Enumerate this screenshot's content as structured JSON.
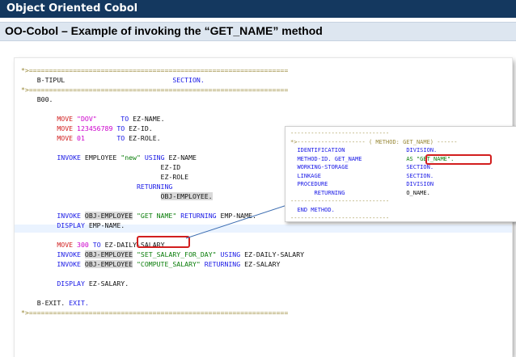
{
  "header": {
    "title": "Object Oriented Cobol",
    "subtitle": "OO-Cobol – Example of invoking the “GET_NAME” method"
  },
  "code": {
    "sep1": "*>=================================================================",
    "section_name": "B-TIPUL",
    "section_kw": "SECTION.",
    "sep2": "*>=================================================================",
    "para": "B00.",
    "move_kw": "MOVE",
    "to_kw": "TO",
    "move1_val": "\"DOV\"",
    "move1_target": "EZ-NAME.",
    "move2_val": "123456789",
    "move2_target": "EZ-ID.",
    "move3_val": "01",
    "move3_target": "EZ-ROLE.",
    "invoke_kw": "INVOKE",
    "invoke1_obj": "EMPLOYEE",
    "invoke1_method": "\"new\"",
    "using_kw": "USING",
    "arg1": "EZ-NAME",
    "arg2": "EZ-ID",
    "arg3": "EZ-ROLE",
    "returning_kw": "RETURNING",
    "ret1": "OBJ-EMPLOYEE.",
    "obj": "OBJ-EMPLOYEE",
    "invoke2_method": "\"GET NAME\"",
    "ret2": "EMP-NAME.",
    "display_kw": "DISPLAY",
    "display1": "EMP-NAME.",
    "move4_val": "300",
    "move4_target": "EZ-DAILY-SALARY",
    "invoke3_method": "\"SET_SALARY_FOR_DAY\"",
    "invoke3_arg": "EZ-DAILY-SALARY",
    "invoke4_method": "\"COMPUTE_SALARY\"",
    "invoke4_ret": "EZ-SALARY",
    "display2": "EZ-SALARY.",
    "exit_para": "B-EXIT.",
    "exit_kw": "EXIT.",
    "sep3": "*>================================================================="
  },
  "popup": {
    "sep_top": "*>--------------------",
    "sep_mid": "( METHOD: GET_NAME) ------",
    "left": [
      "IDENTIFICATION",
      "METHOD-ID. GET_NAME",
      "WORKING-STORAGE",
      "LINKAGE",
      "PROCEDURE",
      "RETURNING"
    ],
    "right": [
      "DIVISION.",
      "AS \"GET_NAME\".",
      "SECTION.",
      "SECTION.",
      "DIVISION",
      "O_NAME."
    ],
    "end": "END METHOD.",
    "dashes": "-----------------------------"
  },
  "colors": {
    "header_bg": "#14385f",
    "subheader_bg": "#dde6f0",
    "keyword": "#1a1ae6",
    "string": "#0a7d0a",
    "highlight_box": "#d21e1e"
  }
}
